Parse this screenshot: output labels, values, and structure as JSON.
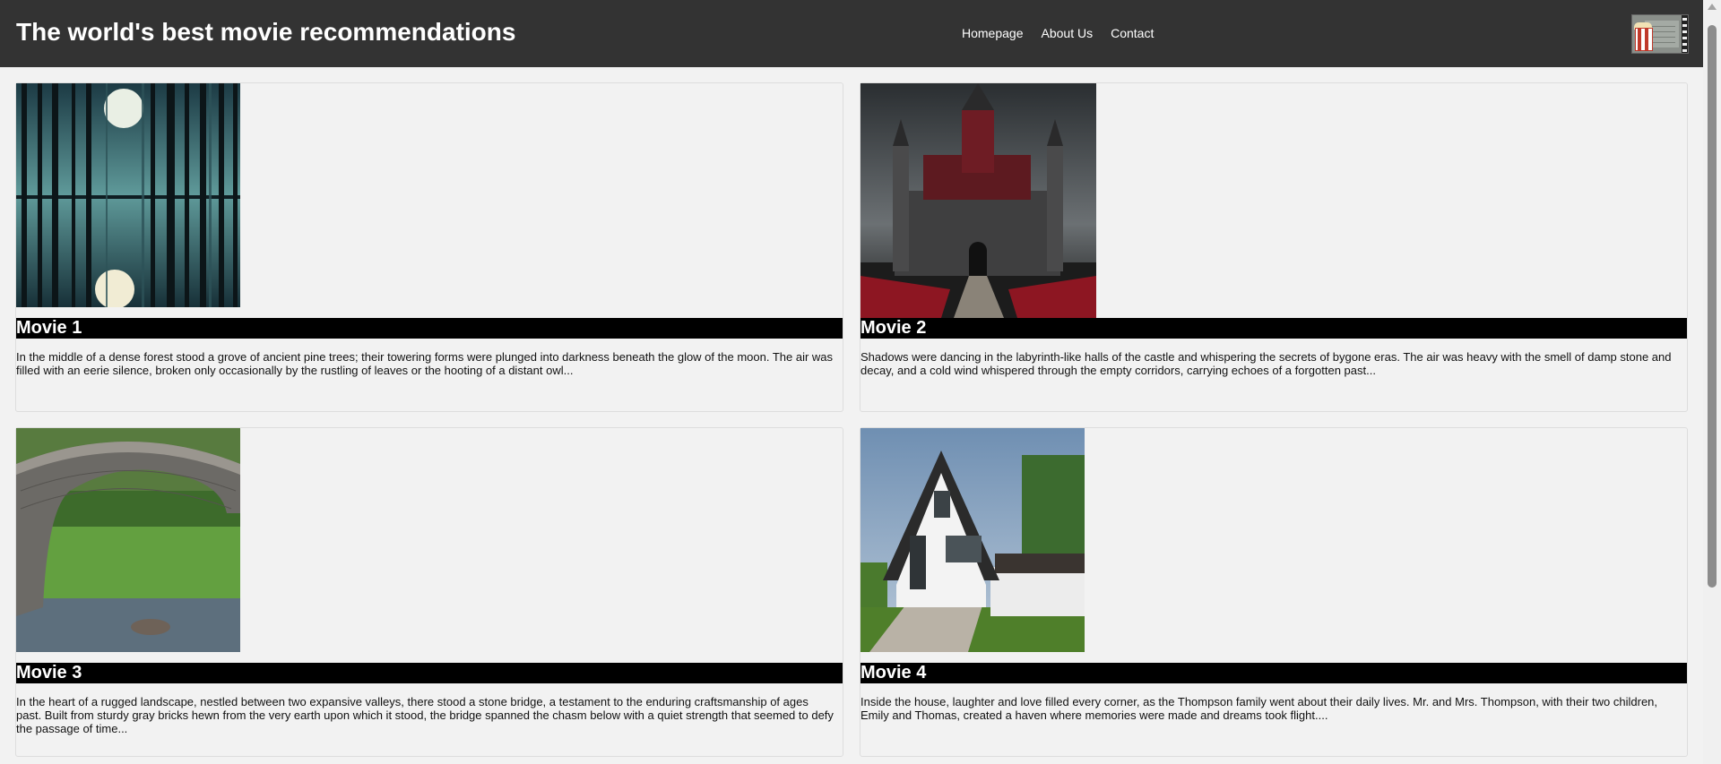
{
  "header": {
    "title": "The world's best movie recommendations",
    "nav": [
      "Homepage",
      "About Us",
      "Contact"
    ],
    "logo_icon": "popcorn-film-logo-icon"
  },
  "movies": [
    {
      "title": "Movie 1",
      "description": "In the middle of a dense forest stood a grove of ancient pine trees; their towering forms were plunged into darkness beneath the glow of the moon. The air was filled with an eerie silence, broken only occasionally by the rustling of leaves or the hooting of a distant owl...",
      "image": "forest-moon-image"
    },
    {
      "title": "Movie 2",
      "description": "Shadows were dancing in the labyrinth-like halls of the castle and whispering the secrets of bygone eras. The air was heavy with the smell of damp stone and decay, and a cold wind whispered through the empty corridors, carrying echoes of a forgotten past...",
      "image": "dark-castle-image"
    },
    {
      "title": "Movie 3",
      "description": "In the heart of a rugged landscape, nestled between two expansive valleys, there stood a stone bridge, a testament to the enduring craftsmanship of ages past. Built from sturdy gray bricks hewn from the very earth upon which it stood, the bridge spanned the chasm below with a quiet strength that seemed to defy the passage of time...",
      "image": "stone-bridge-image"
    },
    {
      "title": "Movie 4",
      "description": "Inside the house, laughter and love filled every corner, as the Thompson family went about their daily lives. Mr. and Mrs. Thompson, with their two children, Emily and Thomas, created a haven where memories were made and dreams took flight....",
      "image": "modern-house-image"
    }
  ],
  "colors": {
    "header_bg": "#333333",
    "title_bar_bg": "#000000",
    "page_bg": "#f2f2f2"
  }
}
